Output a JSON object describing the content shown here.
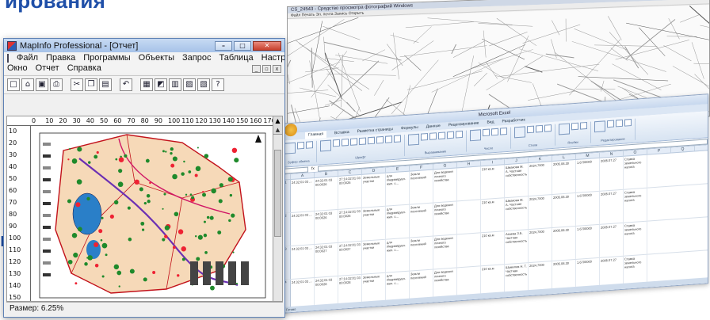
{
  "slide": {
    "title_fragment": "ирования",
    "left_fragment": "и"
  },
  "cad_window": {
    "title": "CS_24543 - Средство просмотра фотографий Windows",
    "menu": "Файл   Печать   Эл. почта   Запись   Открыть"
  },
  "excel_window": {
    "title": "Microsoft Excel",
    "tabs": [
      "Главная",
      "Вставка",
      "Разметка страницы",
      "Формулы",
      "Данные",
      "Рецензирование",
      "Вид",
      "Разработчик"
    ],
    "ribbon_groups": [
      "Буфер обмена",
      "Шрифт",
      "Выравнивание",
      "Число",
      "Стили",
      "Ячейки",
      "Редактирование"
    ],
    "column_headers": [
      "A",
      "B",
      "C",
      "D",
      "E",
      "F",
      "G",
      "H",
      "I",
      "J",
      "K",
      "L",
      "M",
      "N",
      "O",
      "P",
      "Q"
    ],
    "rows": [
      [
        "24:32:01 03 ...",
        "24:32:01 03 00:0026",
        "27:14:32:01 03 00:0026",
        "Земельные участки",
        "для Индивидуал. жил. с...",
        "Земли поселений",
        "Для ведения личного хозяйства",
        "",
        "210 кв.м",
        "Шмакова М. А. Частная собственность",
        "2024.7000",
        "2005.08.30",
        "1.6700000",
        "2005.07.27",
        "Ставка земельного налога"
      ],
      [
        "24:32:01 03 ...",
        "24:32:01 03 00:0026",
        "27:14:32:01 03 00:0026",
        "Земельные участки",
        "для Индивидуал. жил. с...",
        "Земли поселений",
        "Для ведения личного хозяйства",
        "",
        "210 кв.м",
        "Шмакова М. А. Частная собственность",
        "2024.7000",
        "2005.08.30",
        "1.6700000",
        "2005.07.27",
        "Ставка земельного налога"
      ],
      [
        "24:32:01 03 ...",
        "24:32:01 03 00:0027",
        "27:14:32:01 03 00:0027",
        "Земельные участки",
        "для Индивидуал. жил. с...",
        "Земли поселений",
        "Для ведения личного хозяйства",
        "",
        "210 кв.м",
        "Азаева З.Б. Частная собственность",
        "2024.7000",
        "2005.08.30",
        "1.6700000",
        "2005.07.27",
        "Ставка земельного налога"
      ],
      [
        "24:32:01 03 ...",
        "24:32:01 03 00:0028",
        "27:14:32:01 03 00:0028",
        "Земельные участки",
        "для Индивидуал. жил. с...",
        "Земли поселений",
        "Для ведения личного хозяйства",
        "",
        "210 кв.м",
        "Шумилов Н. Т. Частная собственность",
        "2024.7000",
        "2005.08.30",
        "1.6700000",
        "2005.07.27",
        "Ставка земельного налога"
      ]
    ],
    "row_numbers": [
      "1",
      "2",
      "3",
      "4"
    ],
    "status": "Готово"
  },
  "mapinfo_window": {
    "title": "MapInfo Professional - [Отчет]",
    "caption_buttons": {
      "minimize": "–",
      "maximize": "□",
      "close": "✕"
    },
    "menu_row1": [
      "Файл",
      "Правка",
      "Программы",
      "Объекты",
      "Запрос",
      "Таблица",
      "Настройки"
    ],
    "menu_row2": [
      "Окно",
      "Отчет",
      "Справка"
    ],
    "mdi_buttons": [
      "_",
      "▫",
      "x"
    ],
    "ruler_h": [
      "0",
      "10",
      "20",
      "30",
      "40",
      "50",
      "60",
      "70",
      "80",
      "90",
      "100",
      "110",
      "120",
      "130",
      "140",
      "150",
      "160",
      "170"
    ],
    "ruler_v": [
      "10",
      "20",
      "30",
      "40",
      "50",
      "60",
      "70",
      "80",
      "90",
      "100",
      "110",
      "120",
      "130",
      "140",
      "150"
    ],
    "status": "Размер: 6.25%",
    "toolbar_icons": [
      "new-document-icon",
      "open-folder-icon",
      "save-icon",
      "print-icon",
      "cut-icon",
      "copy-icon",
      "paste-icon",
      "undo-icon",
      "layout-icon",
      "new-map-icon",
      "new-browser-icon",
      "new-graph-icon",
      "new-layout-icon",
      "help-pointer-icon"
    ]
  },
  "colors": {
    "slide_text": "#1f4fa8",
    "map_fill": "#f6d9b8",
    "map_border": "#c2121b",
    "map_green": "#1f8a2b",
    "map_water": "#2a7fc8",
    "map_road": "#6b2fb3"
  }
}
